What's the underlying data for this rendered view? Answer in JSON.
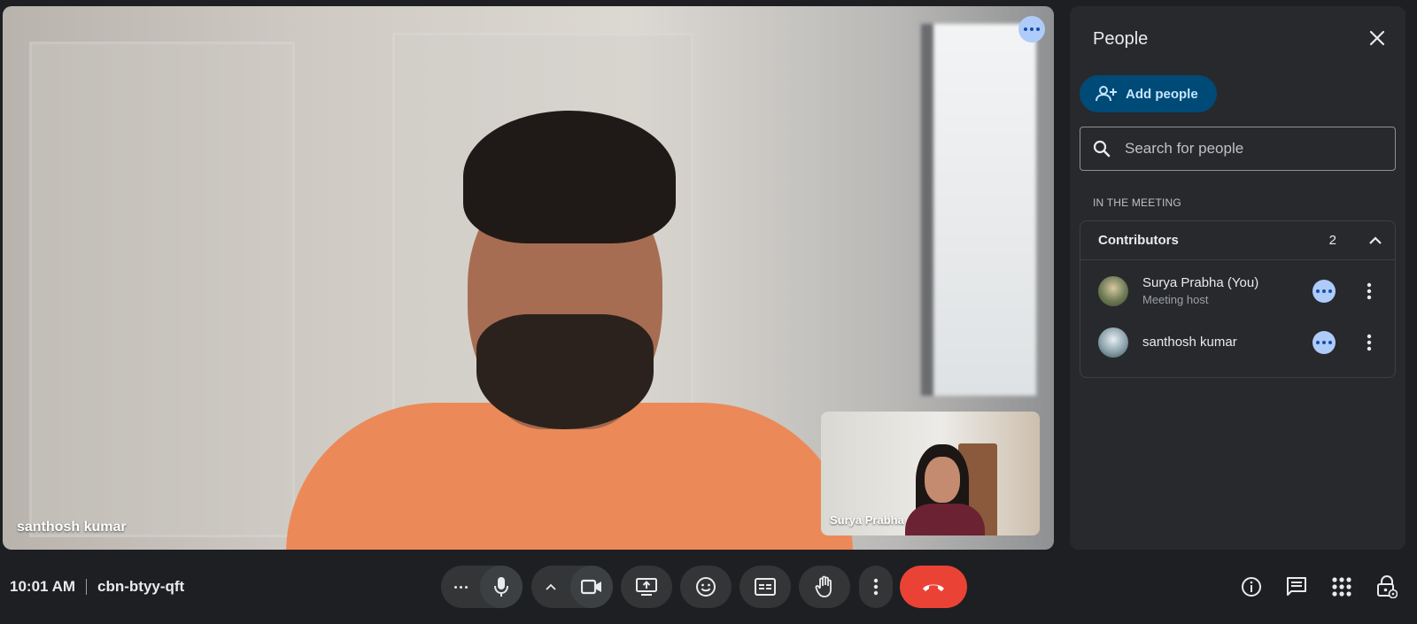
{
  "main_video": {
    "participant_name": "santhosh kumar"
  },
  "self_view": {
    "participant_name": "Surya Prabha"
  },
  "people_panel": {
    "title": "People",
    "add_people_label": "Add people",
    "search_placeholder": "Search for people",
    "section_label": "IN THE MEETING",
    "group": {
      "label": "Contributors",
      "count": "2",
      "members": [
        {
          "name": "Surya Prabha (You)",
          "subtitle": "Meeting host"
        },
        {
          "name": "santhosh kumar",
          "subtitle": ""
        }
      ]
    }
  },
  "bottom_bar": {
    "time": "10:01 AM",
    "meeting_code": "cbn-btyy-qft"
  },
  "colors": {
    "accent_pill": "#aecbfa",
    "add_button_bg": "#004a77",
    "end_call": "#ea4335",
    "shirt": "#eb8a58"
  },
  "icons": [
    "more-horiz-icon",
    "close-icon",
    "person-add-icon",
    "search-icon",
    "chevron-up-icon",
    "more-vert-icon",
    "mic-icon",
    "videocam-icon",
    "present-icon",
    "emoji-icon",
    "captions-icon",
    "raise-hand-icon",
    "end-call-icon",
    "info-icon",
    "chat-icon",
    "apps-icon",
    "host-controls-icon"
  ]
}
